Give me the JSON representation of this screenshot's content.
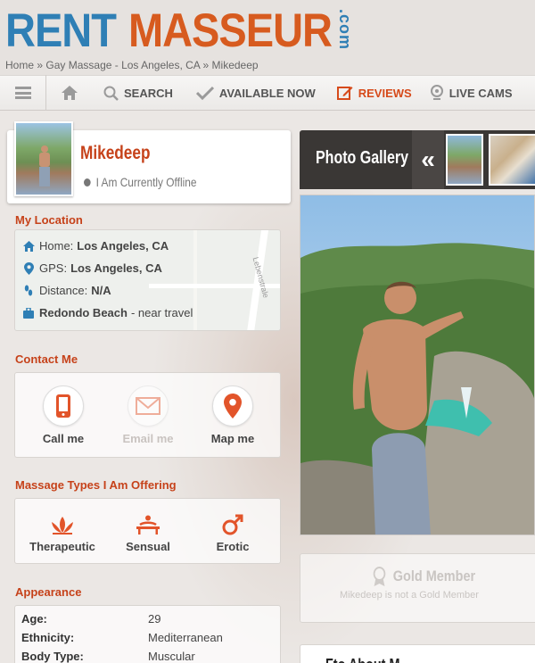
{
  "logo": {
    "rent": "RENT",
    "masseur": "MASSEUR",
    "com": ".com"
  },
  "breadcrumb": {
    "home": "Home",
    "sep1": "»",
    "category": "Gay Massage - Los Angeles, CA",
    "sep2": "»",
    "current": "Mikedeep"
  },
  "nav": {
    "search": "SEARCH",
    "available": "AVAILABLE NOW",
    "reviews": "REVIEWS",
    "cams": "LIVE CAMS"
  },
  "profile": {
    "name": "Mikedeep",
    "status": "I Am Currently Offline"
  },
  "location": {
    "title": "My Location",
    "home_label": "Home:",
    "home_value": "Los Angeles, CA",
    "gps_label": "GPS:",
    "gps_value": "Los Angeles, CA",
    "distance_label": "Distance:",
    "distance_value": "N/A",
    "travel_place": "Redondo Beach",
    "travel_note": "- near travel",
    "map_road": "Lebenstrale"
  },
  "contact": {
    "title": "Contact Me",
    "call": "Call me",
    "email": "Email me",
    "map": "Map me"
  },
  "massage_types": {
    "title": "Massage Types I Am Offering",
    "items": [
      "Therapeutic",
      "Sensual",
      "Erotic"
    ]
  },
  "appearance": {
    "title": "Appearance",
    "rows": [
      {
        "label": "Age:",
        "value": "29"
      },
      {
        "label": "Ethnicity:",
        "value": "Mediterranean"
      },
      {
        "label": "Body Type:",
        "value": "Muscular"
      }
    ]
  },
  "gallery": {
    "title": "Photo Gallery",
    "prev": "«"
  },
  "gold": {
    "title": "Gold Member",
    "text": "Mikedeep is not a Gold Member"
  },
  "about": {
    "title": "Fto About M"
  },
  "colors": {
    "brand_blue": "#2f7fb5",
    "brand_orange": "#d75b1f",
    "accent_red": "#c6421a"
  }
}
